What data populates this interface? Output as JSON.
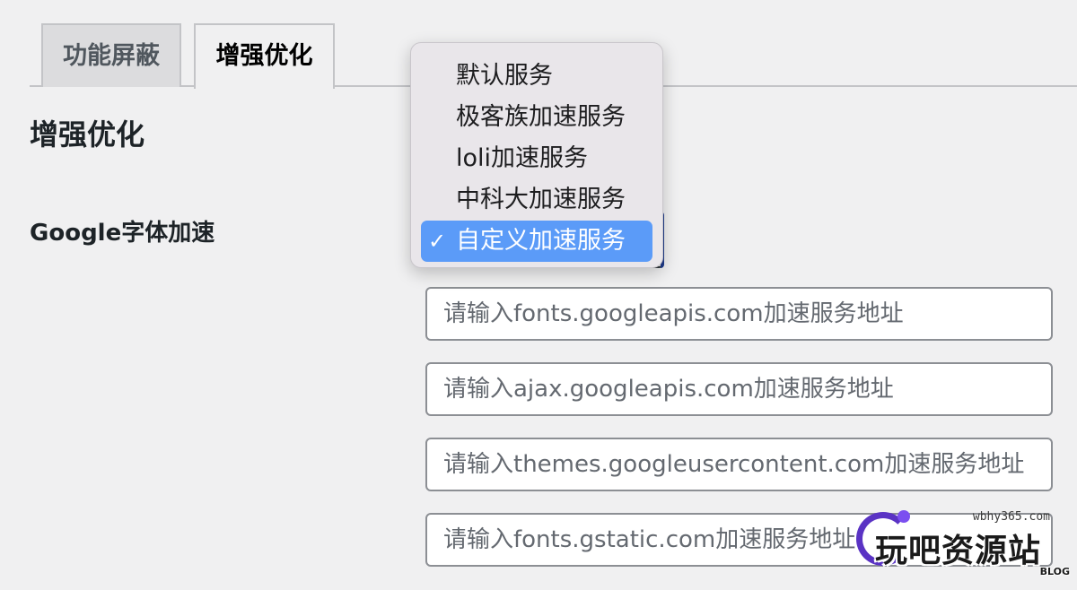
{
  "tabs": [
    {
      "label": "功能屏蔽",
      "active": false
    },
    {
      "label": "增强优化",
      "active": true
    }
  ],
  "section": {
    "title": "增强优化"
  },
  "field": {
    "label": "Google字体加速"
  },
  "dropdown": {
    "options": [
      {
        "label": "默认服务"
      },
      {
        "label": "极客族加速服务"
      },
      {
        "label": "loli加速服务"
      },
      {
        "label": "中科大加速服务"
      },
      {
        "label": "自定义加速服务",
        "selected": true
      }
    ],
    "check_glyph": "✓"
  },
  "inputs": [
    {
      "placeholder": "请输入fonts.googleapis.com加速服务地址",
      "value": ""
    },
    {
      "placeholder": "请输入ajax.googleapis.com加速服务地址",
      "value": ""
    },
    {
      "placeholder": "请输入themes.googleusercontent.com加速服务地址",
      "value": ""
    },
    {
      "placeholder": "请输入fonts.gstatic.com加速服务地址",
      "value": ""
    }
  ],
  "watermark": {
    "site": "wbhy365.com",
    "brand": "玩吧资源站",
    "sub": "BLOG"
  },
  "colors": {
    "selected_bg": "#5b9bf8",
    "page_bg": "#f0f0f1",
    "accent": "#5a33c4"
  }
}
